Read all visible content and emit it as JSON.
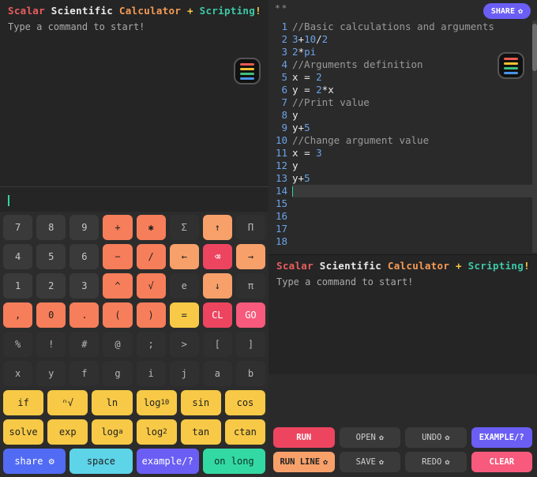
{
  "title": {
    "w1": "Scalar",
    "w2": "Scientific",
    "w3": "Calculator",
    "plus": "+",
    "w4": "Scripting",
    "bang": "!"
  },
  "prompt": "Type a command to start!",
  "dirty_marker": "**",
  "share_label": "SHARE",
  "editor": {
    "line_numbers": [
      "1",
      "2",
      "3",
      "4",
      "5",
      "6",
      "7",
      "8",
      "9",
      "10",
      "11",
      "12",
      "13",
      "14",
      "15",
      "16",
      "17",
      "18"
    ],
    "lines": [
      [
        {
          "t": "//Basic calculations and arguments",
          "c": "t-gray"
        }
      ],
      [
        {
          "t": "3",
          "c": "t-blue"
        },
        {
          "t": "+",
          "c": "t-white"
        },
        {
          "t": "10",
          "c": "t-blue"
        },
        {
          "t": "/",
          "c": "t-white"
        },
        {
          "t": "2",
          "c": "t-blue"
        }
      ],
      [
        {
          "t": "2",
          "c": "t-blue"
        },
        {
          "t": "*",
          "c": "t-white"
        },
        {
          "t": "pi",
          "c": "t-blue"
        }
      ],
      [],
      [
        {
          "t": "//Arguments definition",
          "c": "t-gray"
        }
      ],
      [
        {
          "t": "x ",
          "c": "t-white"
        },
        {
          "t": "= ",
          "c": "t-white"
        },
        {
          "t": "2",
          "c": "t-blue"
        }
      ],
      [
        {
          "t": "y ",
          "c": "t-white"
        },
        {
          "t": "= ",
          "c": "t-white"
        },
        {
          "t": "2",
          "c": "t-blue"
        },
        {
          "t": "*",
          "c": "t-white"
        },
        {
          "t": "x",
          "c": "t-white"
        }
      ],
      [],
      [
        {
          "t": "//Print value",
          "c": "t-gray"
        }
      ],
      [
        {
          "t": "y",
          "c": "t-white"
        }
      ],
      [
        {
          "t": "y",
          "c": "t-white"
        },
        {
          "t": "+",
          "c": "t-white"
        },
        {
          "t": "5",
          "c": "t-blue"
        }
      ],
      [],
      [
        {
          "t": "//Change argument value",
          "c": "t-gray"
        }
      ],
      [
        {
          "t": "x ",
          "c": "t-white"
        },
        {
          "t": "= ",
          "c": "t-white"
        },
        {
          "t": "3",
          "c": "t-blue"
        }
      ],
      [],
      [
        {
          "t": "y",
          "c": "t-white"
        }
      ],
      [
        {
          "t": "y",
          "c": "t-white"
        },
        {
          "t": "+",
          "c": "t-white"
        },
        {
          "t": "5",
          "c": "t-blue"
        }
      ],
      []
    ]
  },
  "keypad": {
    "rows": [
      [
        {
          "l": "7",
          "s": "k-dark"
        },
        {
          "l": "8",
          "s": "k-dark"
        },
        {
          "l": "9",
          "s": "k-dark"
        },
        {
          "l": "+",
          "s": "k-coral"
        },
        {
          "l": "✱",
          "s": "k-coral"
        },
        {
          "l": "Σ",
          "s": "k-darker"
        },
        {
          "l": "↑",
          "s": "k-orange"
        },
        {
          "l": "Π",
          "s": "k-darker"
        }
      ],
      [
        {
          "l": "4",
          "s": "k-dark"
        },
        {
          "l": "5",
          "s": "k-dark"
        },
        {
          "l": "6",
          "s": "k-dark"
        },
        {
          "l": "−",
          "s": "k-coral"
        },
        {
          "l": "/",
          "s": "k-coral"
        },
        {
          "l": "←",
          "s": "k-orange"
        },
        {
          "l": "⌫",
          "s": "k-red"
        },
        {
          "l": "→",
          "s": "k-orange"
        }
      ],
      [
        {
          "l": "1",
          "s": "k-dark"
        },
        {
          "l": "2",
          "s": "k-dark"
        },
        {
          "l": "3",
          "s": "k-dark"
        },
        {
          "l": "^",
          "s": "k-coral"
        },
        {
          "l": "√",
          "s": "k-coral"
        },
        {
          "l": "e",
          "s": "k-darker"
        },
        {
          "l": "↓",
          "s": "k-orange"
        },
        {
          "l": "π",
          "s": "k-darker"
        }
      ],
      [
        {
          "l": ",",
          "s": "k-coral"
        },
        {
          "l": "0",
          "s": "k-coral"
        },
        {
          "l": ".",
          "s": "k-coral"
        },
        {
          "l": "(",
          "s": "k-coral"
        },
        {
          "l": ")",
          "s": "k-coral"
        },
        {
          "l": "=",
          "s": "k-yellow"
        },
        {
          "l": "CL",
          "s": "k-red"
        },
        {
          "l": "GO",
          "s": "k-pink"
        }
      ],
      [
        {
          "l": "%",
          "s": "k-darker"
        },
        {
          "l": "!",
          "s": "k-darker"
        },
        {
          "l": "#",
          "s": "k-darker"
        },
        {
          "l": "@",
          "s": "k-darker"
        },
        {
          "l": ";",
          "s": "k-darker"
        },
        {
          "l": ">",
          "s": "k-darker"
        },
        {
          "l": "[",
          "s": "k-darker"
        },
        {
          "l": "]",
          "s": "k-darker"
        }
      ],
      [
        {
          "l": "x",
          "s": "k-darker"
        },
        {
          "l": "y",
          "s": "k-darker"
        },
        {
          "l": "f",
          "s": "k-darker"
        },
        {
          "l": "g",
          "s": "k-darker"
        },
        {
          "l": "i",
          "s": "k-darker"
        },
        {
          "l": "j",
          "s": "k-darker"
        },
        {
          "l": "a",
          "s": "k-darker"
        },
        {
          "l": "b",
          "s": "k-darker"
        }
      ],
      [
        {
          "l": "if",
          "s": "k-yellow"
        },
        {
          "l": "ⁿ√",
          "s": "k-yellow"
        },
        {
          "l": "ln",
          "s": "k-yellow"
        },
        {
          "l": "log₁₀",
          "s": "k-yellow"
        },
        {
          "l": "sin",
          "s": "k-yellow"
        },
        {
          "l": "cos",
          "s": "k-yellow"
        }
      ],
      [
        {
          "l": "solve",
          "s": "k-yellow"
        },
        {
          "l": "exp",
          "s": "k-yellow"
        },
        {
          "l": "logₐ",
          "s": "k-yellow"
        },
        {
          "l": "log₂",
          "s": "k-yellow"
        },
        {
          "l": "tan",
          "s": "k-yellow"
        },
        {
          "l": "ctan",
          "s": "k-yellow"
        }
      ],
      [
        {
          "l": "share ⚙",
          "s": "k-blue",
          "w": 2
        },
        {
          "l": "space",
          "s": "k-cyan",
          "w": 2
        },
        {
          "l": "example/?",
          "s": "k-purple",
          "w": 2
        },
        {
          "l": "on long",
          "s": "k-teal",
          "w": 2
        }
      ]
    ]
  },
  "actions": {
    "row1": [
      {
        "l": "RUN",
        "s": "ab-red"
      },
      {
        "l": "OPEN ⚙",
        "s": "ab-gray"
      },
      {
        "l": "UNDO ⚙",
        "s": "ab-gray"
      },
      {
        "l": "EXAMPLE/?",
        "s": "ab-purple"
      }
    ],
    "row2": [
      {
        "l": "RUN LINE ⚙",
        "s": "ab-orange"
      },
      {
        "l": "SAVE ⚙",
        "s": "ab-gray"
      },
      {
        "l": "REDO ⚙",
        "s": "ab-gray"
      },
      {
        "l": "CLEAR",
        "s": "ab-pink"
      }
    ]
  }
}
